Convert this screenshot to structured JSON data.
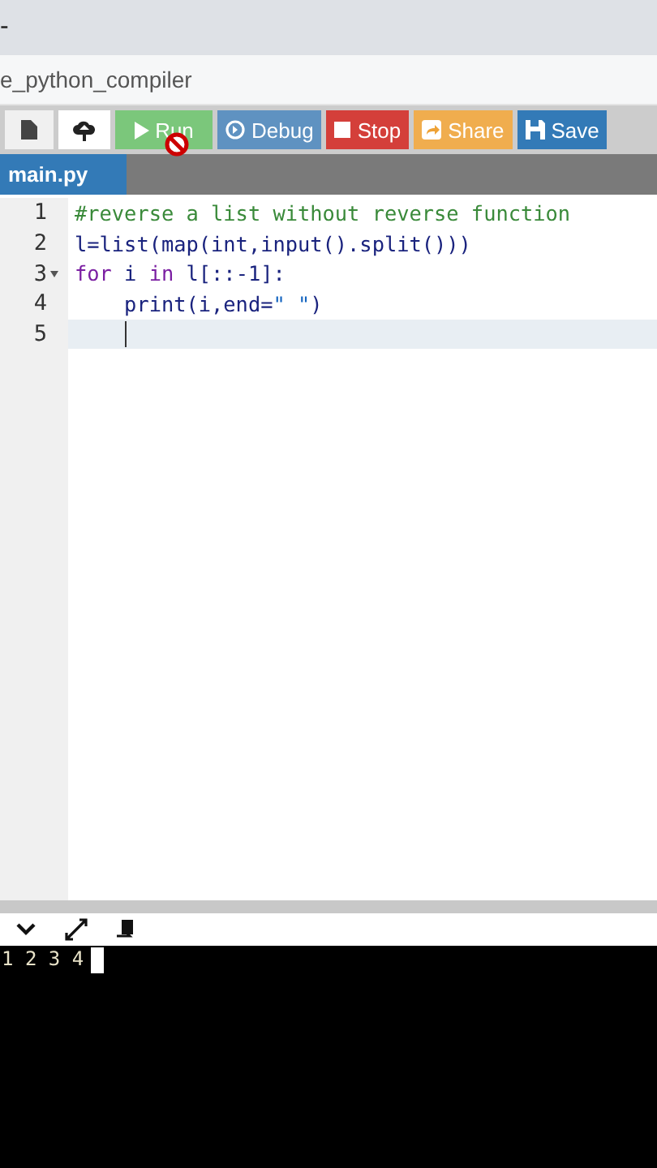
{
  "browser": {
    "title_fragment": "-",
    "address": "e_python_compiler"
  },
  "toolbar": [
    {
      "kind": "file"
    },
    {
      "kind": "upload"
    },
    {
      "kind": "run",
      "label": "Run"
    },
    {
      "kind": "debug",
      "label": "Debug"
    },
    {
      "kind": "stop",
      "label": "Stop"
    },
    {
      "kind": "share",
      "label": "Share"
    },
    {
      "kind": "save",
      "label": "Save"
    }
  ],
  "tabs": [
    {
      "label": "main.py",
      "selected": true
    }
  ],
  "editor": {
    "lines": [
      {
        "number": "1",
        "foldable": false,
        "active": false,
        "tokens": [
          {
            "kind": "comment",
            "text": "#reverse a list without reverse function"
          }
        ]
      },
      {
        "number": "2",
        "foldable": false,
        "active": false,
        "tokens": [
          {
            "kind": "plain",
            "text": "l=list(map(int,input().split()))"
          }
        ]
      },
      {
        "number": "3",
        "foldable": true,
        "active": false,
        "tokens": [
          {
            "kind": "keyword",
            "text": "for"
          },
          {
            "kind": "plain",
            "text": " i "
          },
          {
            "kind": "keyword",
            "text": "in"
          },
          {
            "kind": "plain",
            "text": " l[::-1]:"
          }
        ]
      },
      {
        "number": "4",
        "foldable": false,
        "active": false,
        "tokens": [
          {
            "kind": "plain",
            "text": "    print(i,end="
          },
          {
            "kind": "string",
            "text": "\" \""
          },
          {
            "kind": "plain",
            "text": ")"
          }
        ]
      },
      {
        "number": "5",
        "foldable": false,
        "active": true
      }
    ]
  },
  "console": {
    "output": "1 2 3 4"
  }
}
